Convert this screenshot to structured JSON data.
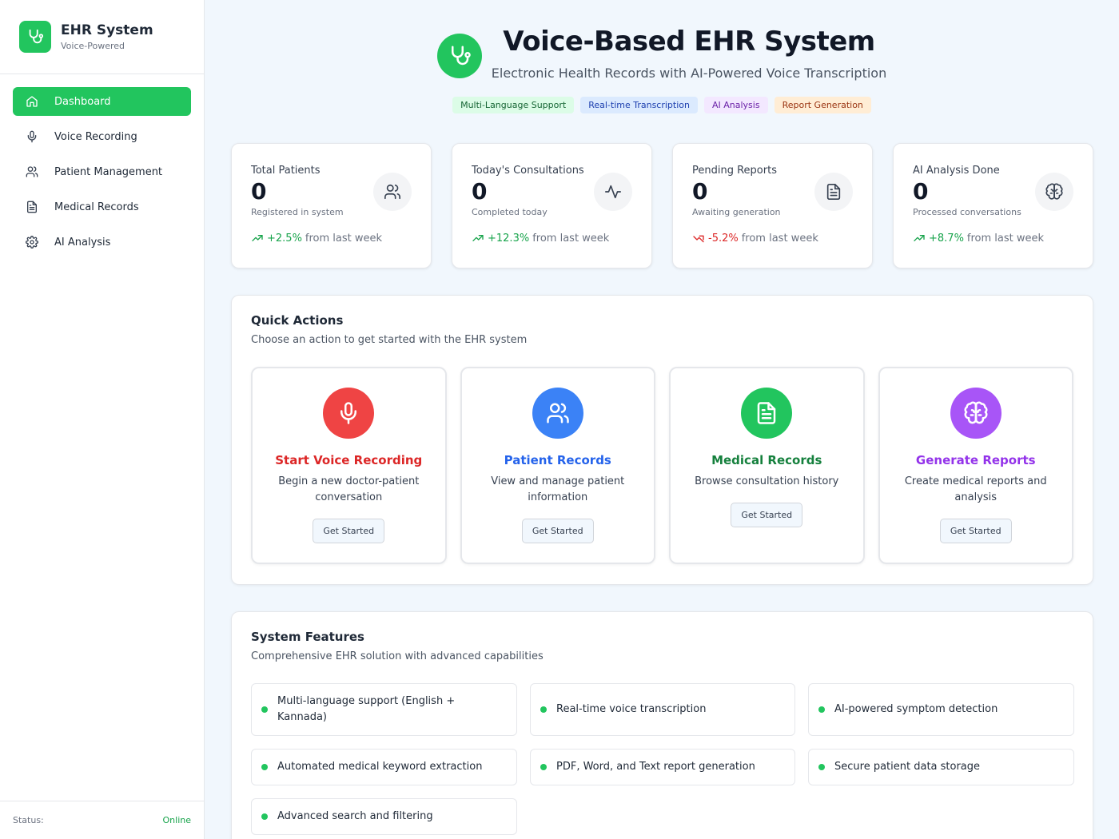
{
  "app": {
    "title": "EHR System",
    "subtitle": "Voice-Powered"
  },
  "sidebar": {
    "items": [
      {
        "label": "Dashboard",
        "icon": "home-icon",
        "active": true
      },
      {
        "label": "Voice Recording",
        "icon": "mic-icon"
      },
      {
        "label": "Patient Management",
        "icon": "users-icon"
      },
      {
        "label": "Medical Records",
        "icon": "file-icon"
      },
      {
        "label": "AI Analysis",
        "icon": "gear-icon"
      }
    ],
    "status_label": "Status:",
    "status_value": "Online"
  },
  "header": {
    "title": "Voice-Based EHR System",
    "subtitle": "Electronic Health Records with AI-Powered Voice Transcription",
    "tags": [
      "Multi-Language Support",
      "Real-time Transcription",
      "AI Analysis",
      "Report Generation"
    ]
  },
  "stats": [
    {
      "label": "Total Patients",
      "value": "0",
      "desc": "Registered in system",
      "trend": "+2.5%",
      "trend_dir": "up",
      "trend_suffix": "from last week",
      "icon": "users-icon"
    },
    {
      "label": "Today's Consultations",
      "value": "0",
      "desc": "Completed today",
      "trend": "+12.3%",
      "trend_dir": "up",
      "trend_suffix": "from last week",
      "icon": "activity-icon"
    },
    {
      "label": "Pending Reports",
      "value": "0",
      "desc": "Awaiting generation",
      "trend": "-5.2%",
      "trend_dir": "down",
      "trend_suffix": "from last week",
      "icon": "file-icon"
    },
    {
      "label": "AI Analysis Done",
      "value": "0",
      "desc": "Processed conversations",
      "trend": "+8.7%",
      "trend_dir": "up",
      "trend_suffix": "from last week",
      "icon": "brain-icon"
    }
  ],
  "quick_actions": {
    "title": "Quick Actions",
    "subtitle": "Choose an action to get started with the EHR system",
    "button_label": "Get Started",
    "cards": [
      {
        "title": "Start Voice Recording",
        "desc": "Begin a new doctor-patient conversation",
        "color": "#dc2626",
        "bg": "#ef4444",
        "icon": "mic-icon"
      },
      {
        "title": "Patient Records",
        "desc": "View and manage patient information",
        "color": "#2563eb",
        "bg": "#3b82f6",
        "icon": "users-icon"
      },
      {
        "title": "Medical Records",
        "desc": "Browse consultation history",
        "color": "#15803d",
        "bg": "#22c55e",
        "icon": "file-icon"
      },
      {
        "title": "Generate Reports",
        "desc": "Create medical reports and analysis",
        "color": "#9333ea",
        "bg": "#a855f7",
        "icon": "brain-icon"
      }
    ]
  },
  "features": {
    "title": "System Features",
    "subtitle": "Comprehensive EHR solution with advanced capabilities",
    "items": [
      "Multi-language support (English + Kannada)",
      "Real-time voice transcription",
      "AI-powered symptom detection",
      "Automated medical keyword extraction",
      "PDF, Word, and Text report generation",
      "Secure patient data storage",
      "Advanced search and filtering"
    ]
  },
  "colors": {
    "accent": "#22c55e",
    "trend_up": "#16a34a",
    "trend_down": "#dc2626",
    "background": "#f1f7fd"
  }
}
